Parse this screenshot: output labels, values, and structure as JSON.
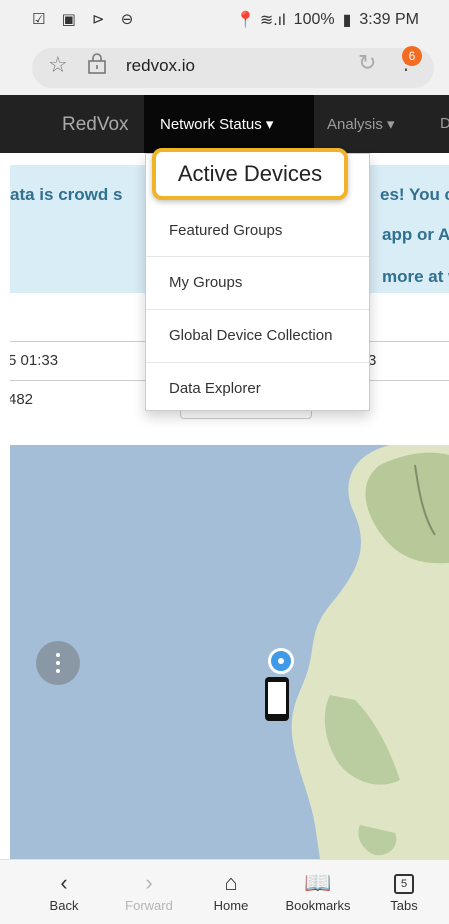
{
  "status_bar": {
    "left_icons": "☑ ▣ ⊳ ⊖",
    "signal": "📍 ≋.ıl",
    "battery": "100%",
    "time": "3:39 PM"
  },
  "browser": {
    "url": "redvox.io",
    "tab_badge": "6"
  },
  "navbar": {
    "brand": "RedVox",
    "network_status": "Network Status ▾",
    "analysis": "Analysis ▾",
    "truncated": "D"
  },
  "alert": {
    "line1_left": "ata is crowd s",
    "line1_right": "es! You c",
    "line2_right": "app or A",
    "line3_right": "more at w"
  },
  "fields": {
    "time_value": "5 01:33",
    "time_right": "3",
    "id_value": "482"
  },
  "dropdown": {
    "highlighted": "Active Devices",
    "items": [
      "Featured Groups",
      "My Groups",
      "Global Device Collection",
      "Data Explorer"
    ]
  },
  "bottom_nav": [
    {
      "label": "Back",
      "icon": "chevron-left-icon"
    },
    {
      "label": "Forward",
      "icon": "chevron-right-icon"
    },
    {
      "label": "Home",
      "icon": "home-icon"
    },
    {
      "label": "Bookmarks",
      "icon": "book-icon"
    },
    {
      "label": "Tabs",
      "icon": "tabs-icon",
      "count": "5"
    }
  ]
}
